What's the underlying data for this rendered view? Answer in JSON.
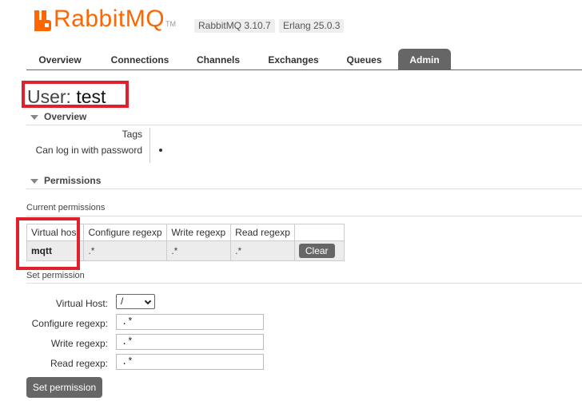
{
  "header": {
    "logo_text": "RabbitMQ",
    "logo_tm": "TM",
    "version_rabbitmq": "RabbitMQ 3.10.7",
    "version_erlang": "Erlang 25.0.3"
  },
  "tabs": [
    {
      "label": "Overview"
    },
    {
      "label": "Connections"
    },
    {
      "label": "Channels"
    },
    {
      "label": "Exchanges"
    },
    {
      "label": "Queues"
    },
    {
      "label": "Admin",
      "active": true
    }
  ],
  "page": {
    "title_prefix": "User:",
    "title_name": "test"
  },
  "overview": {
    "heading": "Overview",
    "tags_label": "Tags",
    "login_label": "Can log in with password"
  },
  "permissions": {
    "heading": "Permissions",
    "current_label": "Current permissions",
    "columns": [
      "Virtual hos",
      "Configure regexp",
      "Write regexp",
      "Read regexp"
    ],
    "rows": [
      {
        "vhost": "mqtt",
        "configure": ".*",
        "write": ".*",
        "read": ".*",
        "action": "Clear"
      }
    ]
  },
  "set_permission": {
    "heading": "Set permission",
    "vhost_label": "Virtual Host:",
    "vhost_value": "/",
    "configure_label": "Configure regexp:",
    "configure_value": ".*",
    "write_label": "Write regexp:",
    "write_value": ".*",
    "read_label": "Read regexp:",
    "read_value": ".*",
    "submit_label": "Set permission"
  },
  "colors": {
    "brand": "#ff6600",
    "tab_active_bg": "#666666",
    "highlight": "#e0202a"
  }
}
